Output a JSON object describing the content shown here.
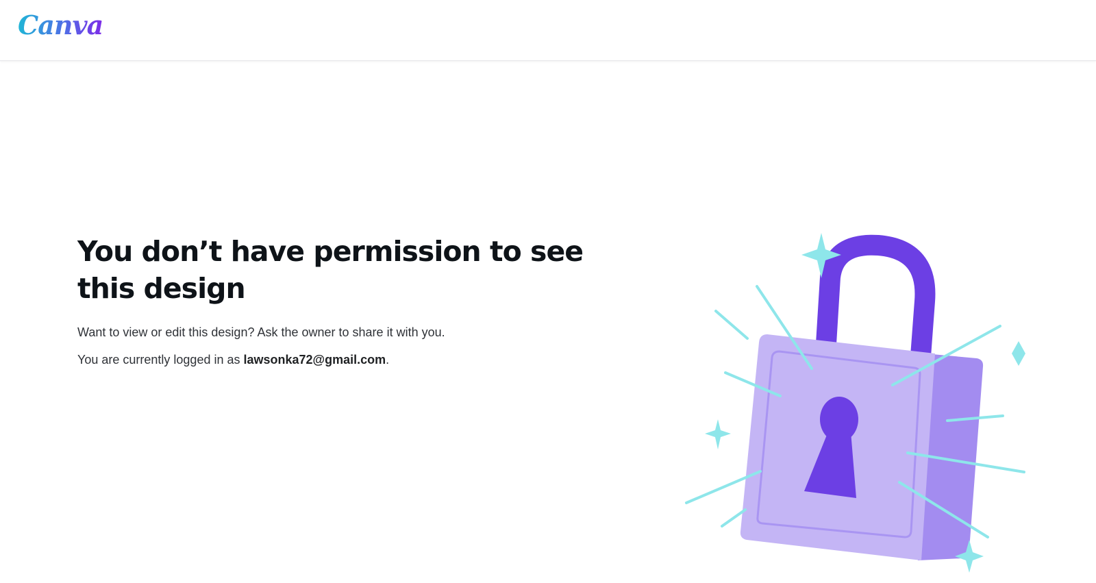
{
  "header": {
    "logo_text": "Canva"
  },
  "main": {
    "title": "You don’t have permission to see this design",
    "message": "Want to view or edit this design? Ask the owner to share it with you.",
    "logged_in_prefix": "You are currently logged in as ",
    "email": "lawsonka72@gmail.com",
    "logged_in_suffix": "."
  },
  "illustration": {
    "icon": "padlock-icon",
    "colors": {
      "shackle": "#6c3fe4",
      "body_front": "#c4b5f5",
      "body_side": "#a38cf0",
      "keyhole": "#6c3fe4",
      "sparkle": "#8ee6ea"
    }
  }
}
